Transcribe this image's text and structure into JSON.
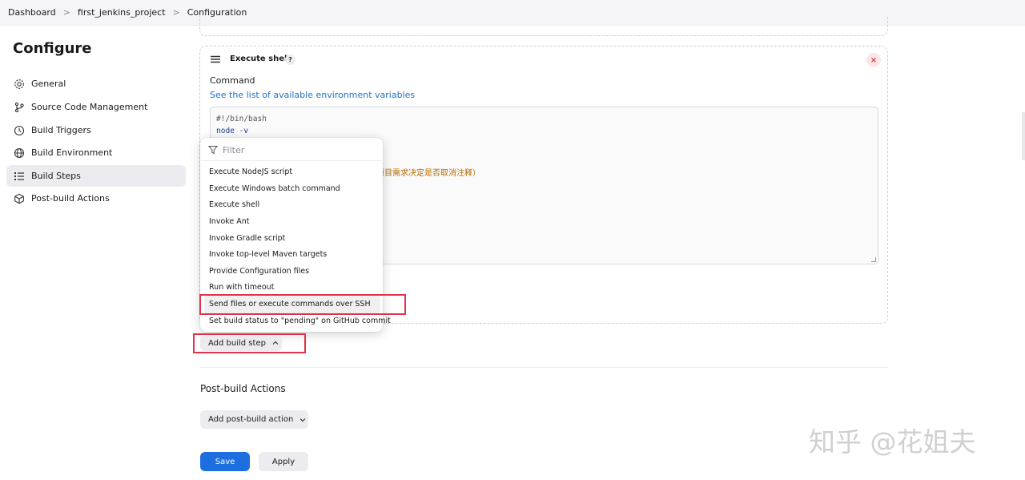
{
  "breadcrumb": [
    "Dashboard",
    "first_jenkins_project",
    "Configuration"
  ],
  "page_title": "Configure",
  "sidebar": {
    "items": [
      {
        "label": "General",
        "icon": "gear-icon"
      },
      {
        "label": "Source Code Management",
        "icon": "branch-icon"
      },
      {
        "label": "Build Triggers",
        "icon": "clock-icon"
      },
      {
        "label": "Build Environment",
        "icon": "globe-icon"
      },
      {
        "label": "Build Steps",
        "icon": "list-icon",
        "active": true
      },
      {
        "label": "Post-build Actions",
        "icon": "cube-icon"
      }
    ]
  },
  "build_step": {
    "title": "Execute shell",
    "help": "?",
    "close": "×",
    "command_label": "Command",
    "env_see": "See",
    "env_link": "the list of available environment variables",
    "code_line_1": "#!/bin/bash",
    "code_line_2": "node -v",
    "code_line_3": "据项目需求决定是否取消注释）"
  },
  "dropdown": {
    "filter_placeholder": "Filter",
    "items": [
      "Execute NodeJS script",
      "Execute Windows batch command",
      "Execute shell",
      "Invoke Ant",
      "Invoke Gradle script",
      "Invoke top-level Maven targets",
      "Provide Configuration files",
      "Run with timeout",
      "Send files or execute commands over SSH",
      "Set build status to \"pending\" on GitHub commit"
    ],
    "highlighted_index": 8
  },
  "add_build_step_label": "Add build step",
  "post_build": {
    "title": "Post-build Actions",
    "add_label": "Add post-build action"
  },
  "buttons": {
    "save": "Save",
    "apply": "Apply"
  },
  "watermark": "知乎 @花姐夫",
  "colors": {
    "primary": "#1d6fe0",
    "link": "#1d70c8",
    "highlight_border": "#e0334b",
    "close_icon": "#e0334b"
  }
}
